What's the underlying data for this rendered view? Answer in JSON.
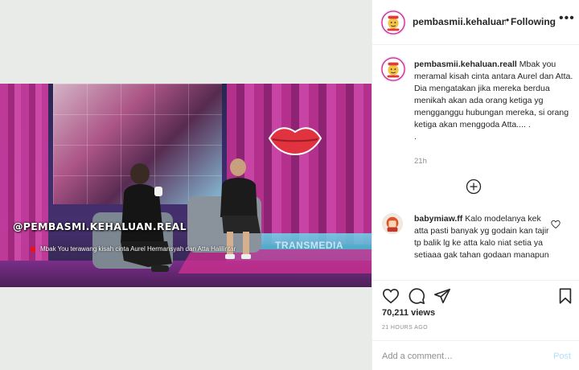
{
  "header": {
    "username": "pembasmii.kehaluan.re",
    "separator": "•",
    "follow_label": "Following",
    "more_icon": "more-horizontal-icon"
  },
  "video": {
    "watermark": "@PEMBASMI.KEHALUAN.REAL",
    "channel_logo": "TRANSMEDIA",
    "caption": "Mbak You terawang kisah cinta Aurel Hermansyah dan Atta Halilintar"
  },
  "caption": {
    "username": "pembasmii.kehaluan.reall",
    "text": "Mbak you meramal kisah cinta antara Aurel dan Atta. Dia mengatakan jika mereka berdua menikah akan ada orang ketiga yg mengganggu hubungan mereka, si orang ketiga akan menggoda Atta.... .",
    "extra": ".",
    "time": "21h"
  },
  "load_more_icon": "plus-circle-icon",
  "comment": {
    "username": "babymiaw.ff",
    "text": "Kalo modelanya kek atta pasti banyak yg godain kan tajir tp balik lg ke atta kalo niat setia ya setiaaa gak tahan godaan manapun"
  },
  "actions": {
    "views": "70,211 views",
    "time_ago": "21 HOURS AGO",
    "add_comment_placeholder": "Add a comment…",
    "post_label": "Post"
  },
  "colors": {
    "post_disabled": "#b2dffc",
    "secondary_text": "#8e8e8e",
    "lips": "#e0323f"
  }
}
